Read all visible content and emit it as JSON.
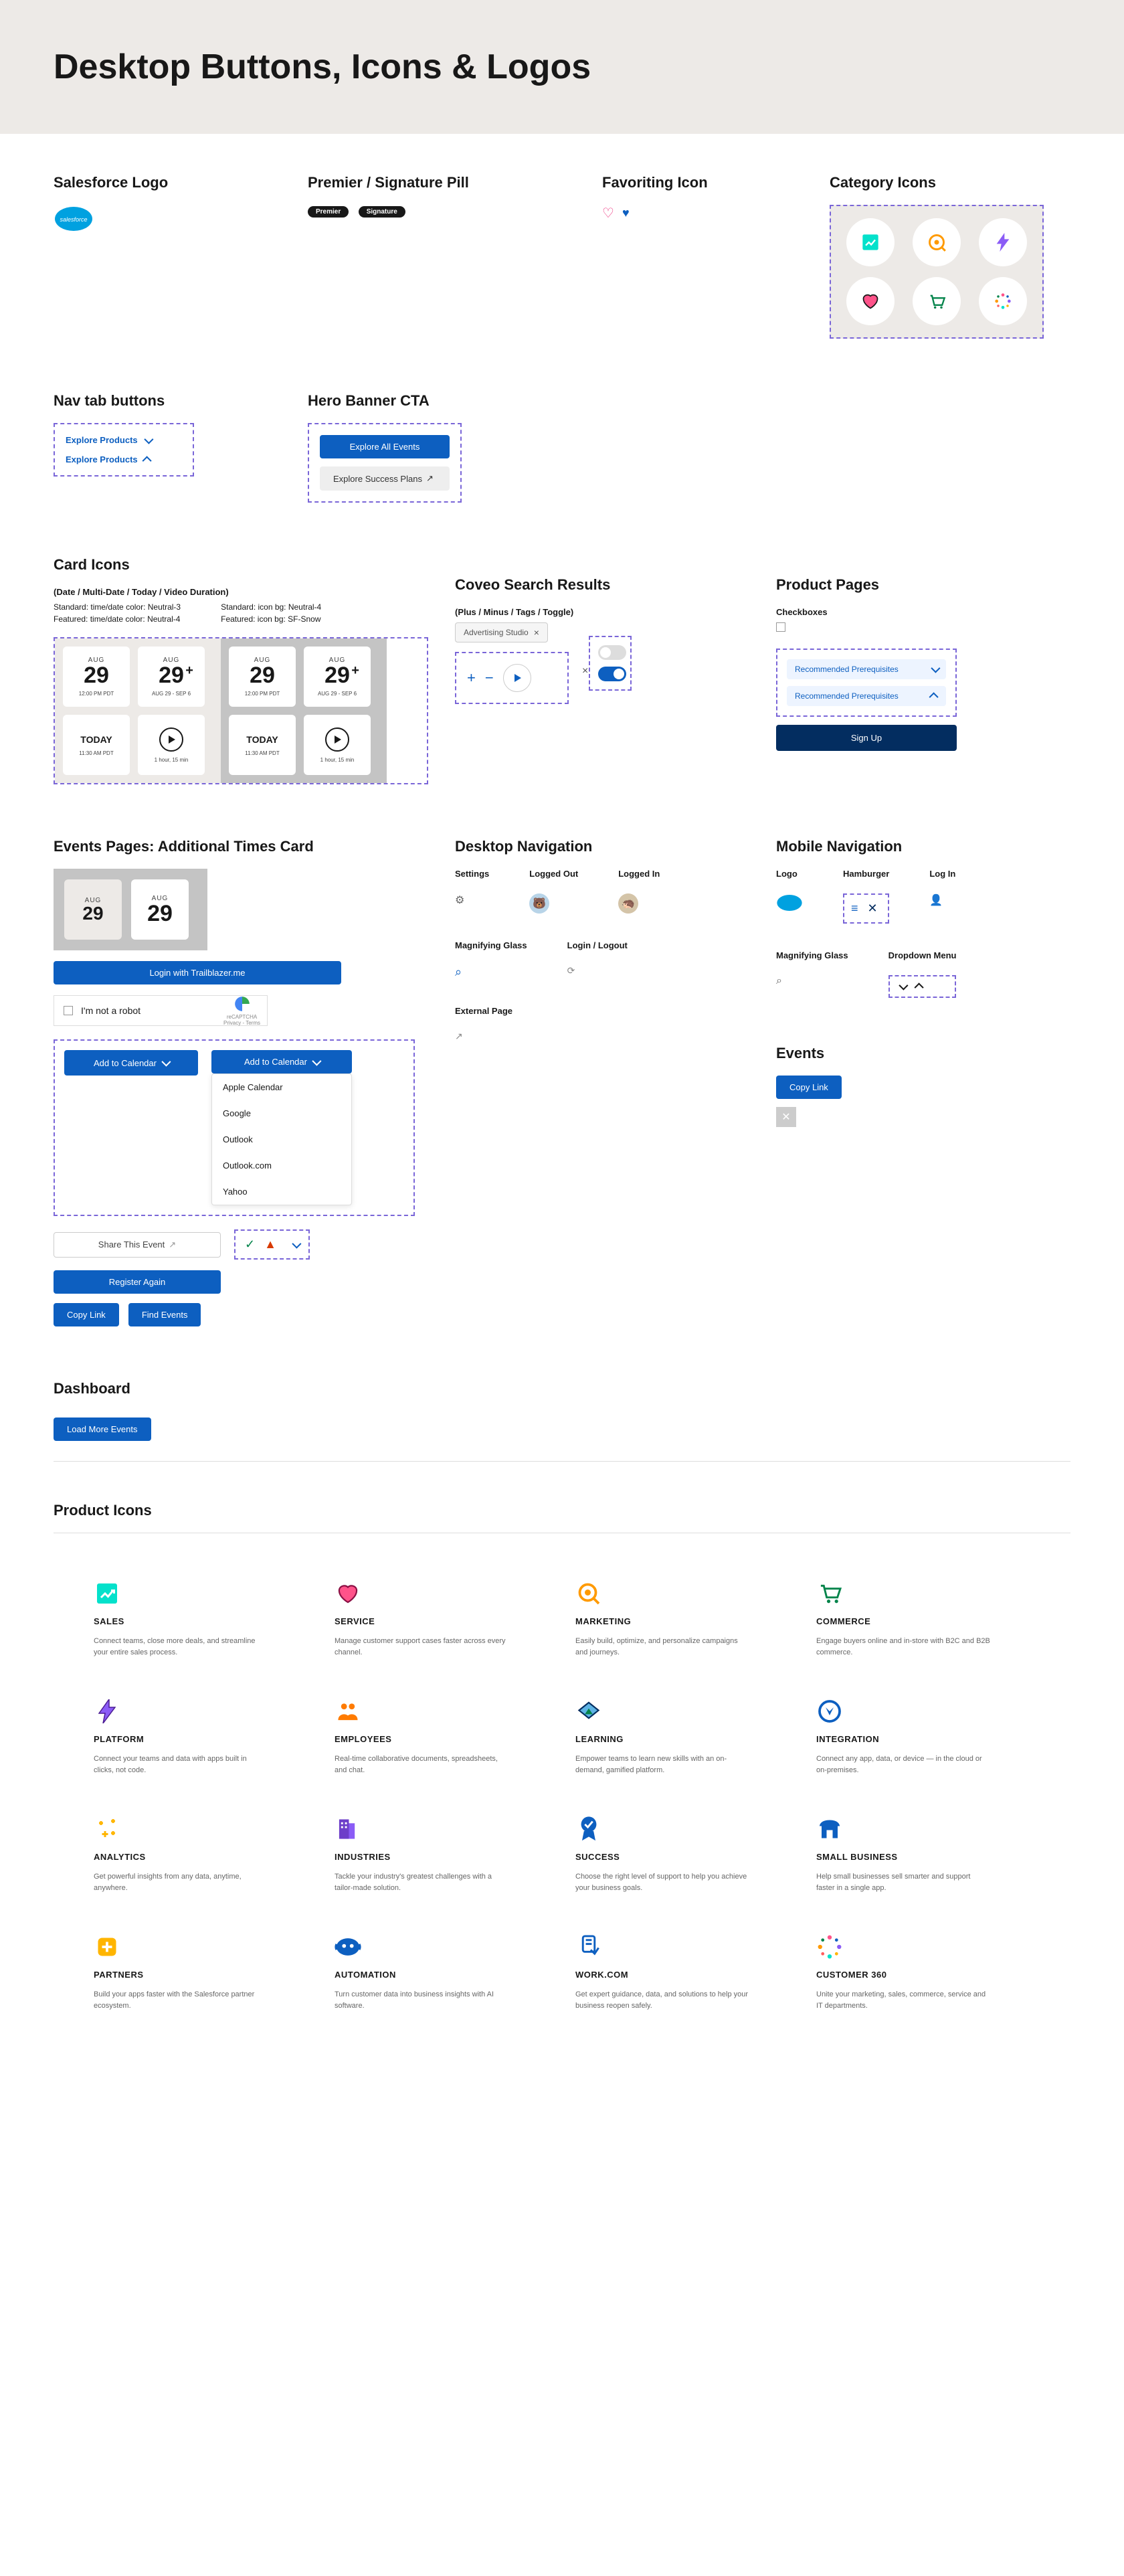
{
  "header": {
    "title": "Desktop Buttons, Icons & Logos"
  },
  "section1": {
    "logo_title": "Salesforce Logo",
    "pill_title": "Premier / Signature Pill",
    "pill1": "Premier",
    "pill2": "Signature",
    "fav_title": "Favoriting Icon",
    "cat_title": "Category Icons"
  },
  "section2": {
    "nav_title": "Nav tab buttons",
    "nav_label": "Explore Products",
    "hero_title": "Hero Banner CTA",
    "hero_btn1": "Explore All Events",
    "hero_btn2": "Explore Success Plans"
  },
  "cards": {
    "title": "Card Icons",
    "subtitle": "(Date / Multi-Date / Today / Video Duration)",
    "meta1": "Standard: time/date color: Neutral-3",
    "meta2": "Standard: icon bg: Neutral-4",
    "meta3": "Featured: time/date color: Neutral-4",
    "meta4": "Featured: icon bg: SF-Snow",
    "month": "AUG",
    "day": "29",
    "tz": "12:00 PM PDT",
    "range": "AUG 29 - SEP 6",
    "today": "TODAY",
    "dur1": "11:30 AM PDT",
    "dur2": "1 hour, 15 min"
  },
  "coveo": {
    "title": "Coveo Search Results",
    "subtitle": "(Plus / Minus / Tags / Toggle)",
    "tag": "Advertising Studio"
  },
  "product": {
    "title": "Product Pages",
    "sub": "Checkboxes",
    "prereq": "Recommended Prerequisites",
    "signup": "Sign Up"
  },
  "events": {
    "title": "Events Pages: Additional Times Card",
    "month": "AUG",
    "day": "29",
    "login_btn": "Login with Trailblazer.me",
    "captcha": "I'm not a robot",
    "captcha_brand": "reCAPTCHA",
    "captcha_meta": "Privacy - Terms",
    "addcal": "Add to Calendar",
    "cal_opts": [
      "Apple Calendar",
      "Google",
      "Outlook",
      "Outlook.com",
      "Yahoo"
    ],
    "share": "Share This Event",
    "register": "Register Again",
    "copy": "Copy Link",
    "find": "Find Events"
  },
  "desknav": {
    "title": "Desktop Navigation",
    "settings": "Settings",
    "logged_out": "Logged Out",
    "logged_in": "Logged In",
    "mag": "Magnifying Glass",
    "login": "Login / Logout",
    "ext": "External Page"
  },
  "mobilenav": {
    "title": "Mobile Navigation",
    "logo": "Logo",
    "ham": "Hamburger",
    "login": "Log In",
    "mag": "Magnifying Glass",
    "dd": "Dropdown Menu"
  },
  "evsec": {
    "title": "Events",
    "copy": "Copy Link"
  },
  "dashboard": {
    "title": "Dashboard",
    "btn": "Load More Events"
  },
  "products": {
    "title": "Product Icons",
    "items": [
      {
        "name": "SALES",
        "desc": "Connect teams, close more deals, and streamline your entire sales process."
      },
      {
        "name": "SERVICE",
        "desc": "Manage customer support cases faster across every channel."
      },
      {
        "name": "MARKETING",
        "desc": "Easily build, optimize, and personalize campaigns and journeys."
      },
      {
        "name": "COMMERCE",
        "desc": "Engage buyers online and in-store with B2C and B2B commerce."
      },
      {
        "name": "PLATFORM",
        "desc": "Connect your teams and data with apps built in clicks, not code."
      },
      {
        "name": "EMPLOYEES",
        "desc": "Real-time collaborative documents, spreadsheets, and chat."
      },
      {
        "name": "LEARNING",
        "desc": "Empower teams to learn new skills with an on-demand, gamified platform."
      },
      {
        "name": "INTEGRATION",
        "desc": "Connect any app, data, or device — in the cloud or on-premises."
      },
      {
        "name": "ANALYTICS",
        "desc": "Get powerful insights from any data, anytime, anywhere."
      },
      {
        "name": "INDUSTRIES",
        "desc": "Tackle your industry's greatest challenges with a tailor-made solution."
      },
      {
        "name": "SUCCESS",
        "desc": "Choose the right level of support to help you achieve your business goals."
      },
      {
        "name": "SMALL BUSINESS",
        "desc": "Help small businesses sell smarter and support faster in a single app."
      },
      {
        "name": "PARTNERS",
        "desc": "Build your apps faster with the Salesforce partner ecosystem."
      },
      {
        "name": "AUTOMATION",
        "desc": "Turn customer data into business insights with AI software."
      },
      {
        "name": "WORK.COM",
        "desc": "Get expert guidance, data, and solutions to help your business reopen safely."
      },
      {
        "name": "CUSTOMER 360",
        "desc": "Unite your marketing, sales, commerce, service and IT departments."
      }
    ]
  }
}
